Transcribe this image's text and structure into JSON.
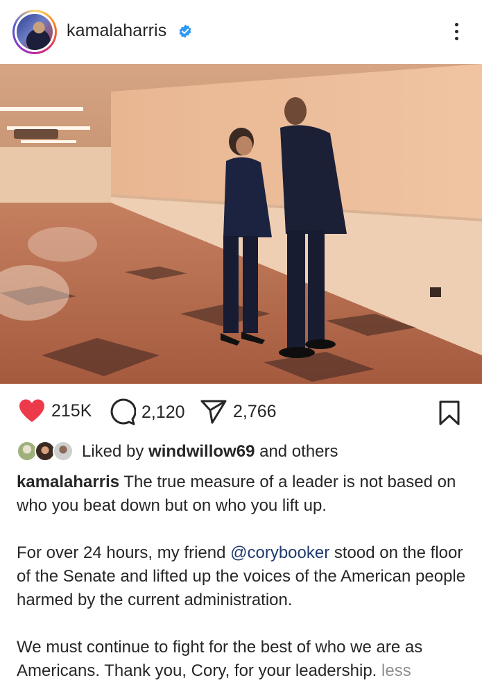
{
  "post": {
    "username": "kamalaharris",
    "verified": true
  },
  "stats": {
    "likes": "215K",
    "comments": "2,120",
    "shares": "2,766"
  },
  "liked_by": {
    "prefix": "Liked by",
    "user": "windwillow69",
    "suffix": "and others"
  },
  "caption": {
    "user": "kamalaharris",
    "p1": "The true measure of a leader is not based on who you beat down but on who you lift up.",
    "p2_before": "For over 24 hours, my friend",
    "p2_mention": "@corybooker",
    "p2_after": "stood on the floor of the Senate and lifted up the voices of the American people harmed by the current administration.",
    "p3": "We must continue to fight for the best of who we are as Americans. Thank you, Cory, for your leadership.",
    "less": "less"
  },
  "icons": {
    "like": "heart-icon",
    "comment": "comment-icon",
    "share": "send-icon",
    "save": "bookmark-icon",
    "more": "more-vertical-icon",
    "verified": "verified-badge-icon"
  },
  "colors": {
    "like": "#ed3a4a",
    "verified": "#2f97f2",
    "mention": "#1f3b6e",
    "muted": "#8e8e8e"
  }
}
